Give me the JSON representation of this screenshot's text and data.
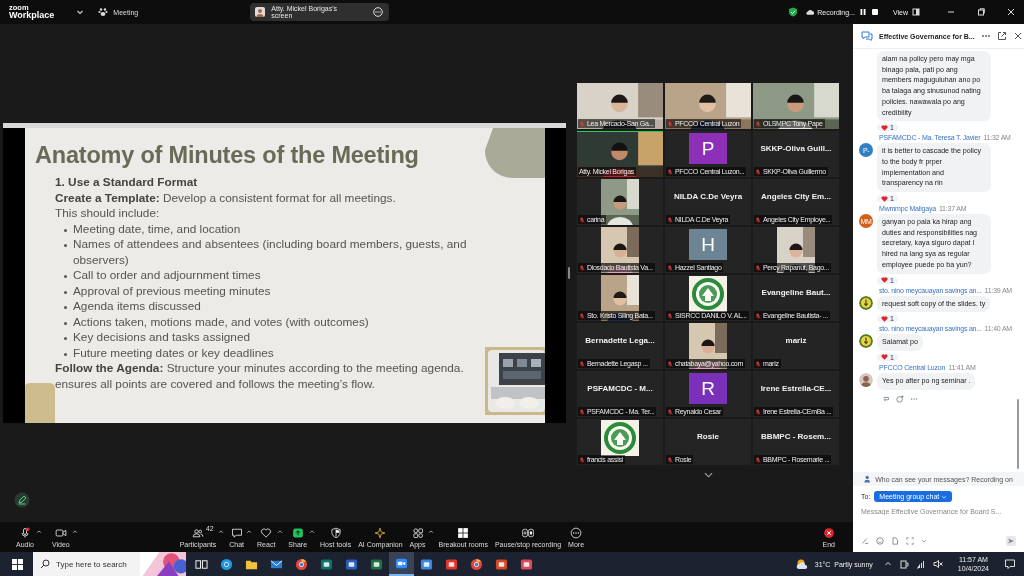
{
  "topbar": {
    "logo_top": "zoom",
    "logo_bottom": "Workplace",
    "meeting": "Meeting",
    "share_pill": "Atty. Mickel Borigas's screen",
    "recording": "Recording...",
    "view": "View"
  },
  "slide": {
    "title": "Anatomy of Minutes of the Meeting",
    "lines": [
      {
        "kind": "heading",
        "text": "1. Use a Standard Format"
      },
      {
        "kind": "para",
        "text": "**Create a Template:** Develop a consistent format for all meetings."
      },
      {
        "kind": "para",
        "text": "This should include:"
      },
      {
        "kind": "bullet",
        "text": "Meeting date, time, and location"
      },
      {
        "kind": "bullet",
        "text": "Names of attendees and absentees (including board members, guests, and observers)"
      },
      {
        "kind": "bullet",
        "text": "Call to order and adjournment times"
      },
      {
        "kind": "bullet",
        "text": "Approval of previous meeting minutes"
      },
      {
        "kind": "bullet",
        "text": "Agenda items discussed"
      },
      {
        "kind": "bullet",
        "text": "Actions taken, motions made, and votes (with outcomes)"
      },
      {
        "kind": "bullet",
        "text": "Key decisions and tasks assigned"
      },
      {
        "kind": "bullet",
        "text": "Future meeting dates or key deadlines"
      },
      {
        "kind": "para",
        "text": "**Follow the Agenda:** Structure your minutes according to the meeting agenda."
      },
      {
        "kind": "para",
        "text": "ensures all points are covered and follows the meeting’s flow."
      }
    ]
  },
  "participants": [
    {
      "kind": "video",
      "label": "Lea Mercado-San Ga...",
      "muted": true,
      "speaking": false
    },
    {
      "kind": "video",
      "label": "PFCCO Central Luzon",
      "muted": true,
      "speaking": false
    },
    {
      "kind": "video",
      "label": "OLSMPC Tony Pape",
      "muted": true,
      "speaking": false
    },
    {
      "kind": "video",
      "label": "Atty. Mickel Borigas",
      "muted": false,
      "speaking": true
    },
    {
      "kind": "avatar",
      "letter": "P",
      "color": "#8e2fb8",
      "label": "PFCCO Central Luzon...",
      "muted": true,
      "speaking": false
    },
    {
      "kind": "name",
      "heading": "SKKP-Oliva  Guill...",
      "label": "SKKP-Oliva Guillermo",
      "muted": true,
      "speaking": false
    },
    {
      "kind": "inset",
      "label": "carina",
      "muted": true,
      "speaking": false
    },
    {
      "kind": "name",
      "heading": "NILDA C.De Veyra",
      "label": "NILDA C.De Veyra",
      "muted": true,
      "speaking": false
    },
    {
      "kind": "name",
      "heading": "Angeles  City  Em...",
      "label": "Angeles City Employe...",
      "muted": true,
      "speaking": false
    },
    {
      "kind": "inset",
      "label": "Diosdado Bautista Va...",
      "muted": true,
      "speaking": false
    },
    {
      "kind": "avatar",
      "letter": "H",
      "color": "#6d8494",
      "label": "Hazzel Santiago",
      "muted": true,
      "speaking": false
    },
    {
      "kind": "inset",
      "label": "Percy Rapanut, Bago...",
      "muted": true,
      "speaking": false
    },
    {
      "kind": "inset",
      "label": "Sto. Kristo Siling Bata...",
      "muted": true,
      "speaking": false
    },
    {
      "kind": "logo",
      "label": "SISRCC DANILO V. AL...",
      "muted": true,
      "speaking": false
    },
    {
      "kind": "name",
      "heading": "Evangeline  Baut...",
      "label": "Evangeline Bautista- ...",
      "muted": true,
      "speaking": false
    },
    {
      "kind": "name",
      "heading": "Bernadette  Lega...",
      "label": "Bernadette Legasp ...",
      "muted": true,
      "speaking": false
    },
    {
      "kind": "inset",
      "label": "chatabaya@yahoo.com",
      "muted": true,
      "speaking": false
    },
    {
      "kind": "name",
      "heading": "mariz",
      "label": "mariz",
      "muted": true,
      "speaking": false
    },
    {
      "kind": "name",
      "heading": "PSFAMCDC  -  M...",
      "label": "PSFAMCDC - Ma. Ter...",
      "muted": true,
      "speaking": false
    },
    {
      "kind": "avatar",
      "letter": "R",
      "color": "#7a30b8",
      "label": "Reynaldo Cesar",
      "muted": true,
      "speaking": false
    },
    {
      "kind": "name",
      "heading": "Irene  Estrella-CE...",
      "label": "Irene Estrella-CEmBa ...",
      "muted": true,
      "speaking": false
    },
    {
      "kind": "logo",
      "label": "francis assisi",
      "muted": true,
      "speaking": false
    },
    {
      "kind": "name",
      "heading": "Rosie",
      "label": "Rosie",
      "muted": true,
      "speaking": false
    },
    {
      "kind": "name",
      "heading": "BBMPC  -  Rosem...",
      "label": "BBMPC - Rosemarie ...",
      "muted": true,
      "speaking": false
    }
  ],
  "chat": {
    "title": "Effective Governance for B...",
    "messages": [
      {
        "text": "alam na policy pero may mga binago pala, pati po ang members maguguluhan ano po ba talaga ang sinusunod nating policies. nawawala po ang credibility",
        "reaction": "1"
      },
      {
        "sender": "PSFAMCDC - Ma. Teresa T. Javier",
        "time": "11:32 AM",
        "avatar": {
          "kind": "initials",
          "text": "P-",
          "color": "#2f7fc1"
        },
        "text": "it is better to cascade the policy to the body fr prper implementation and transparency na rin",
        "reaction": "1"
      },
      {
        "sender": "Mwmmpc Maligaya",
        "time": "11:37 AM",
        "avatar": {
          "kind": "initials",
          "text": "MM",
          "color": "#d2601a"
        },
        "text": "ganyan po pala ka hirap ang duties and responsibilities nag secretary, kaya siguro dapat  I hired na lang sya as regular employee puede po ba yun?",
        "reaction": "1"
      },
      {
        "sender": "sto. nino meycauayan savings an...",
        "time": "11:39 AM",
        "avatar": {
          "kind": "logo"
        },
        "text": "request soft copy of the slides. ty",
        "reaction": "1"
      },
      {
        "sender": "sto. nino meycauayan savings an...",
        "time": "11:40 AM",
        "avatar": {
          "kind": "logo"
        },
        "text": "Salamat po",
        "reaction": "1"
      },
      {
        "sender": "PFCCO Central Luzon",
        "time": "11:41 AM",
        "text": "Yes po after po ng seminar ."
      }
    ],
    "privacy": "Who can see your messages? Recording on",
    "to_label": "To:",
    "recipient": "Meeting group chat",
    "placeholder": "Message Effective Governance for Board S..."
  },
  "toolbar": [
    {
      "kind": "audio",
      "label": "Audio",
      "menu": true
    },
    {
      "kind": "video",
      "label": "Video",
      "menu": true
    },
    {
      "kind": "participants",
      "label": "Participants",
      "count": "42",
      "menu": true
    },
    {
      "kind": "chat",
      "label": "Chat",
      "menu": true
    },
    {
      "kind": "react",
      "label": "React",
      "menu": true
    },
    {
      "kind": "share",
      "label": "Share",
      "menu": true
    },
    {
      "kind": "host",
      "label": "Host tools",
      "menu": false
    },
    {
      "kind": "ai",
      "label": "AI Companion",
      "menu": false
    },
    {
      "kind": "apps",
      "label": "Apps",
      "menu": true
    },
    {
      "kind": "breakout",
      "label": "Breakout rooms",
      "menu": false
    },
    {
      "kind": "recording",
      "label": "Pause/stop recording",
      "menu": false
    },
    {
      "kind": "more",
      "label": "More",
      "menu": false
    },
    {
      "kind": "end",
      "label": "End",
      "menu": false
    }
  ],
  "taskbar": {
    "search_placeholder": "Type here to search",
    "apps": [
      {
        "kind": "taskview",
        "selected": false
      },
      {
        "kind": "edge",
        "selected": false
      },
      {
        "kind": "explorer",
        "selected": false
      },
      {
        "kind": "mail",
        "selected": false
      },
      {
        "kind": "chrome",
        "selected": false
      },
      {
        "kind": "publisher",
        "selected": false
      },
      {
        "kind": "word",
        "selected": false
      },
      {
        "kind": "excel",
        "selected": false
      },
      {
        "kind": "zoom",
        "selected": true
      },
      {
        "kind": "calendar",
        "selected": false
      },
      {
        "kind": "red",
        "selected": false
      },
      {
        "kind": "chrome",
        "selected": false
      },
      {
        "kind": "powerpoint",
        "selected": false
      },
      {
        "kind": "snip",
        "selected": false
      }
    ],
    "weather": "31°C  Partly sunny",
    "time": "11:57 AM",
    "date": "10/4/2024"
  }
}
